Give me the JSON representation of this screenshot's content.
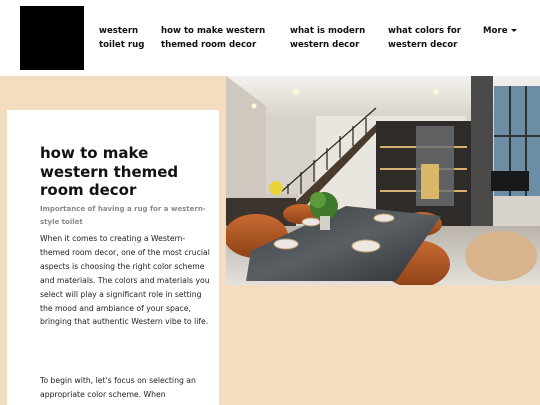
{
  "nav": {
    "items": [
      {
        "line1": "western",
        "line2": "toilet rug"
      },
      {
        "line1": "how to make western",
        "line2": "themed room decor"
      },
      {
        "line1": "what is modern",
        "line2": "western decor"
      },
      {
        "line1": "what colors for",
        "line2": "western decor"
      }
    ],
    "more_label": "More"
  },
  "article": {
    "title": "how to make western themed room decor",
    "subtitle": "Importance of having a rug for a western-style toilet",
    "paragraphs": [
      "When it comes to creating a Western-themed room decor, one of the most crucial aspects is choosing the right color scheme and materials. The colors and materials you select will play a significant role in setting the mood and ambiance of your space, bringing that authentic Western vibe to life.",
      "To begin with, let's focus on selecting an appropriate color scheme. When"
    ]
  },
  "colors": {
    "hero_background": "#f3dcc0",
    "logo": "#000000"
  },
  "icons": {
    "more": "caret-down-icon"
  }
}
